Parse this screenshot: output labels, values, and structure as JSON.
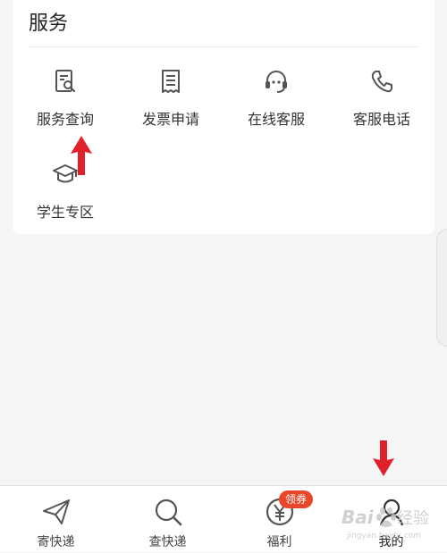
{
  "services": {
    "title": "服务",
    "items": [
      {
        "label": "服务查询",
        "icon": "search-document-icon"
      },
      {
        "label": "发票申请",
        "icon": "invoice-icon"
      },
      {
        "label": "在线客服",
        "icon": "headset-icon"
      },
      {
        "label": "客服电话",
        "icon": "phone-icon"
      },
      {
        "label": "学生专区",
        "icon": "graduation-cap-icon"
      }
    ]
  },
  "tabbar": {
    "tabs": [
      {
        "label": "寄快递",
        "icon": "paper-plane-icon"
      },
      {
        "label": "查快递",
        "icon": "search-icon"
      },
      {
        "label": "福利",
        "icon": "yen-coin-icon",
        "badge": "领券"
      },
      {
        "label": "我的",
        "icon": "user-icon"
      }
    ]
  },
  "colors": {
    "accent": "#e8462a",
    "arrow": "#e0202b",
    "icon": "#555555",
    "background": "#f5f5f5",
    "card": "#ffffff"
  }
}
